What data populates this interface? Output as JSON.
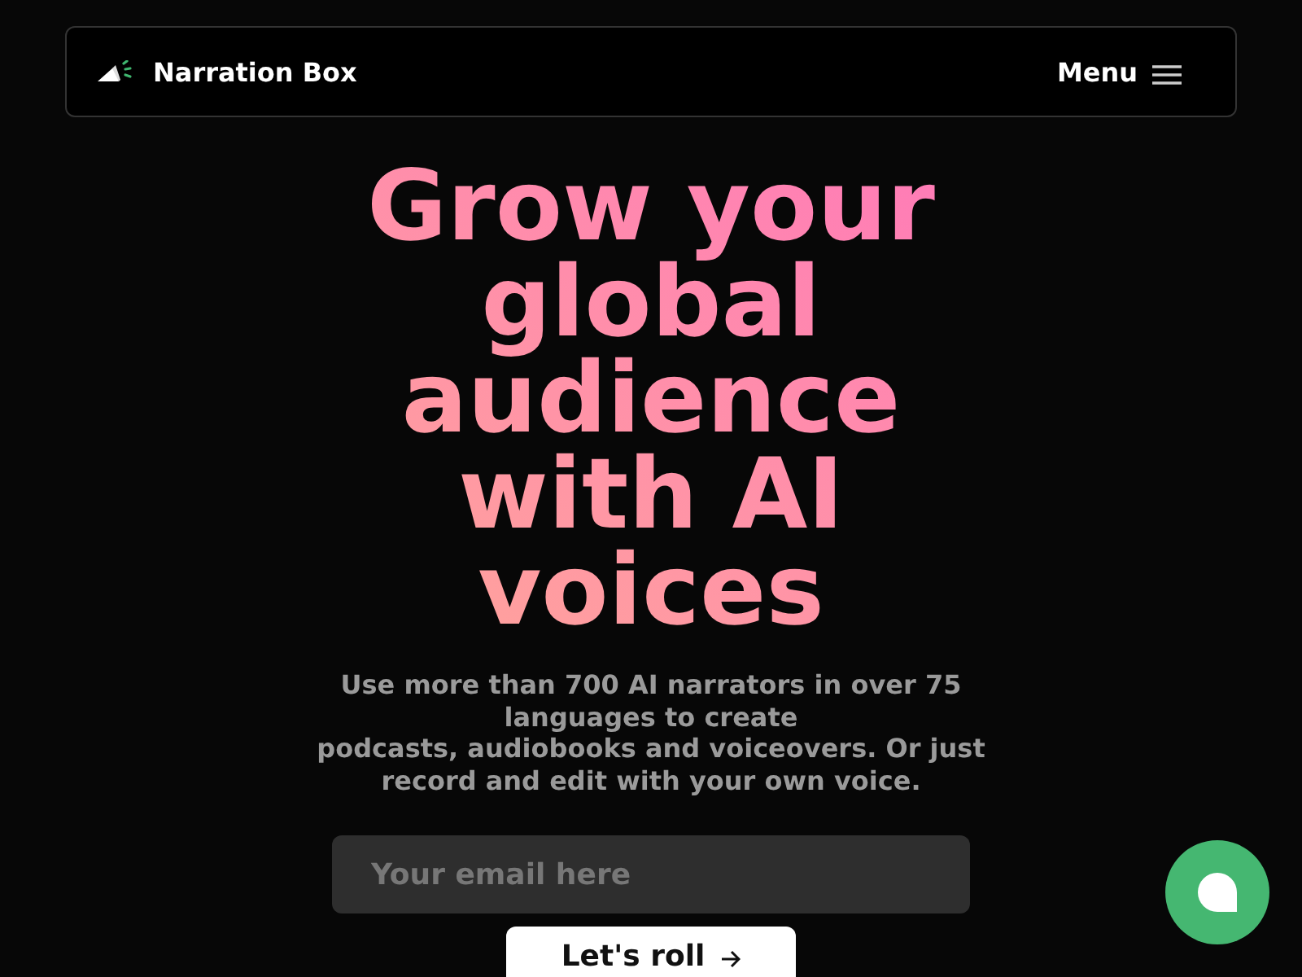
{
  "nav": {
    "brand": "Narration Box",
    "menu": "Menu"
  },
  "hero": {
    "heading": "Grow your global audience with AI voices",
    "subtitle": "Use more than 700 AI narrators in over 75 languages to create\npodcasts, audiobooks and voiceovers. Or just record and edit with your own voice.",
    "email_field": {
      "placeholder": "Your email here"
    },
    "cta": "Let's roll"
  }
}
